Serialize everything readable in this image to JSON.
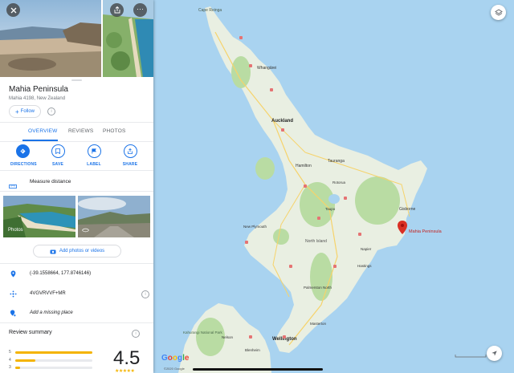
{
  "place": {
    "name": "Mahia Peninsula",
    "address": "Mahia 4198, New Zealand",
    "follow_label": "Follow"
  },
  "tabs": [
    {
      "label": "OVERVIEW",
      "active": true
    },
    {
      "label": "REVIEWS",
      "active": false
    },
    {
      "label": "PHOTOS",
      "active": false
    }
  ],
  "actions": [
    {
      "label": "DIRECTIONS",
      "icon": "directions-icon"
    },
    {
      "label": "SAVE",
      "icon": "bookmark-icon"
    },
    {
      "label": "LABEL",
      "icon": "flag-icon"
    },
    {
      "label": "SHARE",
      "icon": "share-icon"
    }
  ],
  "measure_label": "Measure distance",
  "photos_label": "Photos",
  "add_photos_label": "Add photos or videos",
  "info": {
    "coordinates": "(-39.1558664, 177.8746146)",
    "plus_code": "4VGVRVVF+MR",
    "missing_place": "Add a missing place"
  },
  "reviews": {
    "title": "Review summary",
    "rating": "4.5",
    "bars": [
      {
        "stars": "5",
        "fraction": 1.0
      },
      {
        "stars": "4",
        "fraction": 0.26
      },
      {
        "stars": "3",
        "fraction": 0.06
      }
    ]
  },
  "map": {
    "pin_label": "Mahia Peninsula",
    "google": "Google",
    "copyright": "©2020 Google",
    "sea_color": "#a9d3f0",
    "land_color": "#e9efe2",
    "forest_color": "#b9dca3",
    "pin_color": "#d93025",
    "labels": [
      "Cape Reinga",
      "Whangārei",
      "Auckland",
      "Hamilton",
      "Tauranga",
      "Rotorua",
      "Taupo",
      "Gisborne",
      "New Plymouth",
      "North Island",
      "Napier",
      "Hastings",
      "Palmerston North",
      "Masterton",
      "Wellington",
      "Nelson",
      "Blenheim",
      "Kahurangi National Park"
    ]
  }
}
